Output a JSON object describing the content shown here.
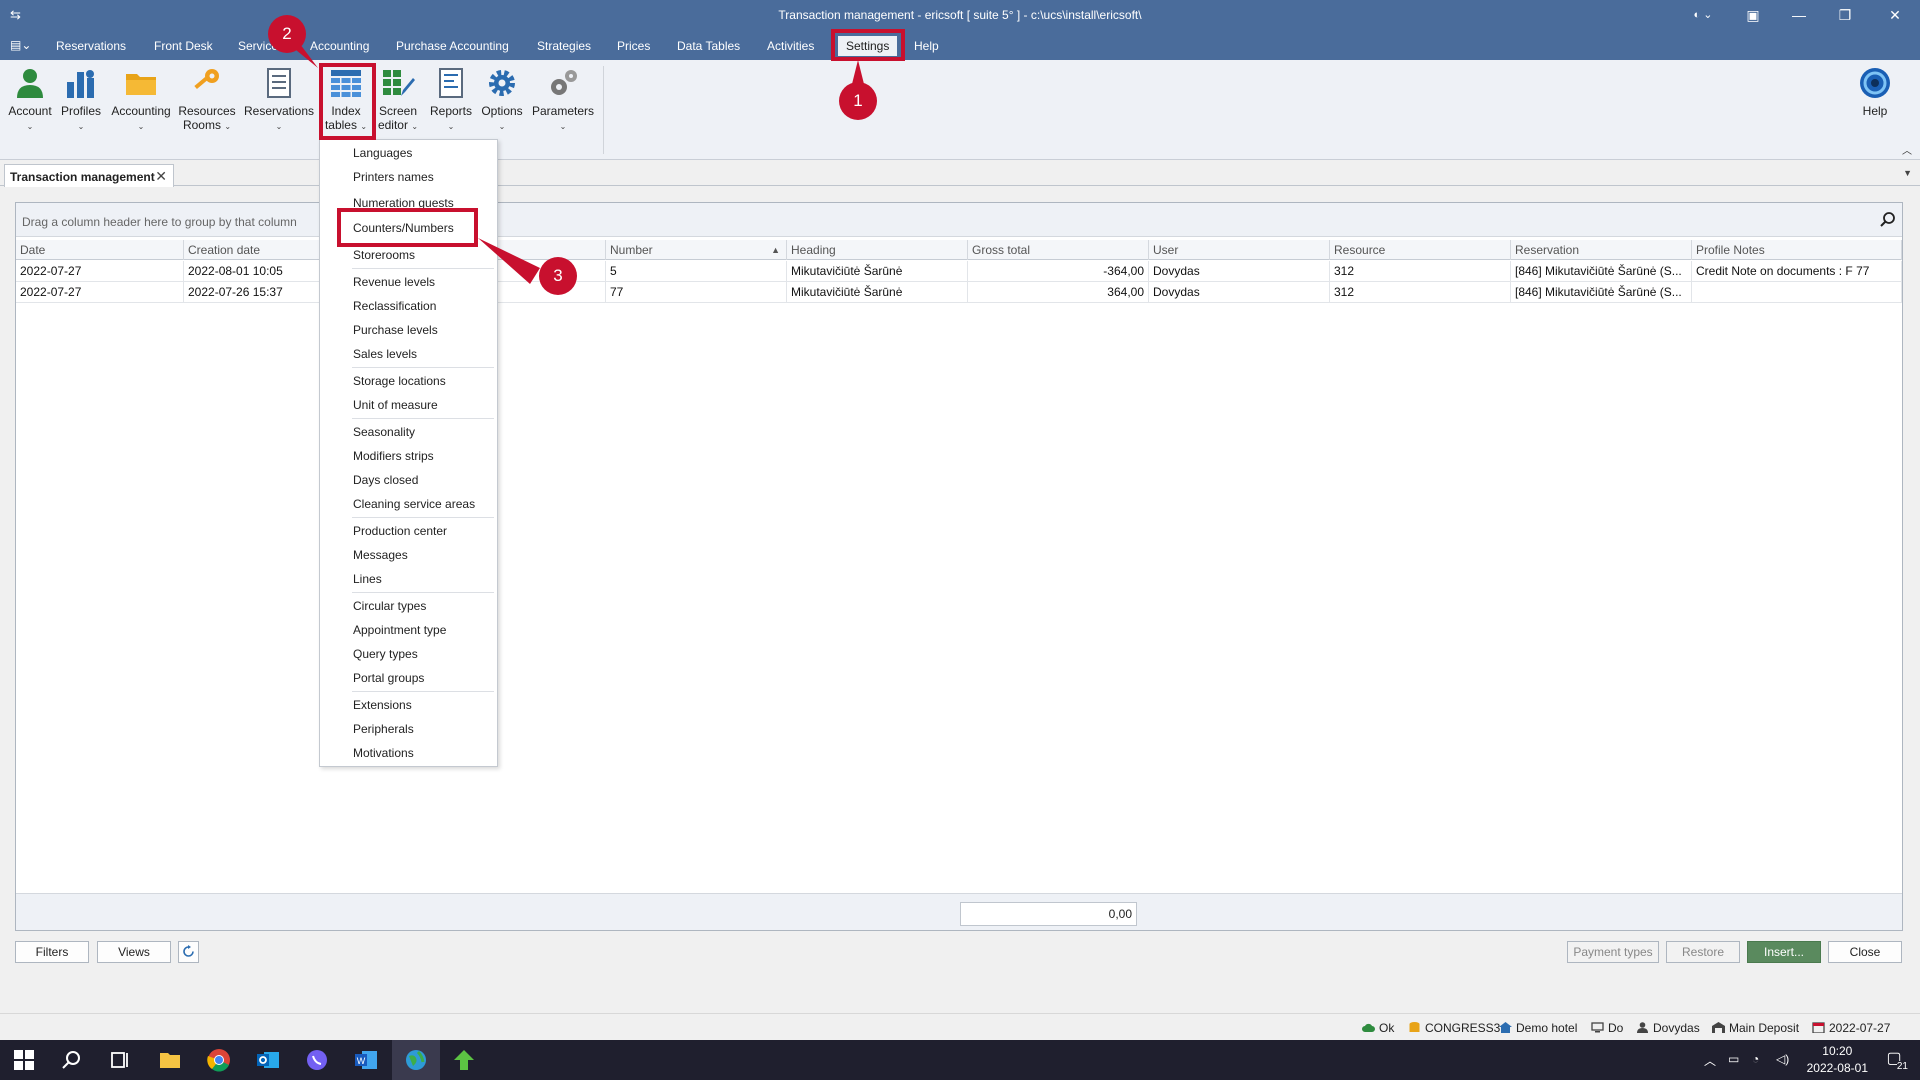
{
  "window": {
    "title": "Transaction management - ericsoft [ suite 5° ] - c:\\ucs\\install\\ericsoft\\"
  },
  "menu": {
    "items": [
      "Reservations",
      "Front Desk",
      "Services",
      "Accounting",
      "Purchase Accounting",
      "Strategies",
      "Prices",
      "Data Tables",
      "Activities",
      "Settings",
      "Help"
    ],
    "active": "Settings"
  },
  "ribbon": {
    "buttons": [
      {
        "line1": "Account",
        "line2": ""
      },
      {
        "line1": "Profiles",
        "line2": ""
      },
      {
        "line1": "Accounting",
        "line2": ""
      },
      {
        "line1": "Resources",
        "line2": "Rooms"
      },
      {
        "line1": "Reservations",
        "line2": ""
      },
      {
        "line1": "Index",
        "line2": "tables"
      },
      {
        "line1": "Screen",
        "line2": "editor"
      },
      {
        "line1": "Reports",
        "line2": ""
      },
      {
        "line1": "Options",
        "line2": ""
      },
      {
        "line1": "Parameters",
        "line2": ""
      }
    ],
    "help": "Help"
  },
  "tab": {
    "label": "Transaction management"
  },
  "grid": {
    "group_hint": "Drag a column header here to group by that column",
    "columns": [
      "Date",
      "Creation date",
      "",
      "Number",
      "Heading",
      "Gross total",
      "User",
      "Resource",
      "Reservation",
      "Profile Notes"
    ],
    "rows": [
      [
        "2022-07-27",
        "2022-08-01 10:05",
        "",
        "5",
        "Mikutavičiūtė Šarūnė",
        "-364,00",
        "Dovydas",
        "312",
        "[846] Mikutavičiūtė Šarūnė (S...",
        "Credit Note on documents : F 77"
      ],
      [
        "2022-07-27",
        "2022-07-26 15:37",
        "",
        "77",
        "Mikutavičiūtė Šarūnė",
        "364,00",
        "Dovydas",
        "312",
        "[846] Mikutavičiūtė Šarūnė (S...",
        ""
      ]
    ],
    "total": "0,00"
  },
  "dropdown": {
    "groups": [
      [
        "Languages",
        "Printers names",
        "Numeration guests",
        "Counters/Numbers",
        "Storerooms"
      ],
      [
        "Revenue levels",
        "Reclassification",
        "Purchase levels",
        "Sales levels"
      ],
      [
        "Storage locations",
        "Unit of measure"
      ],
      [
        "Seasonality",
        "Modifiers strips",
        "Days closed",
        "Cleaning service areas"
      ],
      [
        "Production center",
        "Messages",
        "Lines"
      ],
      [
        "Circular types",
        "Appointment type",
        "Query types",
        "Portal groups"
      ],
      [
        "Extensions",
        "Peripherals",
        "Motivations"
      ]
    ]
  },
  "buttons": {
    "filters": "Filters",
    "views": "Views",
    "payment_types": "Payment types",
    "restore": "Restore",
    "insert": "Insert...",
    "close": "Close"
  },
  "status": {
    "connection": "Ok",
    "database": "CONGRESS3",
    "hotel": "Demo hotel",
    "workstation": "Do",
    "user": "Dovydas",
    "deposit": "Main Deposit",
    "date": "2022-07-27"
  },
  "taskbar": {
    "time": "10:20",
    "date": "2022-08-01",
    "notifications": "21"
  },
  "annotations": [
    "1",
    "2",
    "3"
  ],
  "colors": {
    "titlebar": "#4a6c9b",
    "annotation": "#c8102e",
    "insert_button": "#5a8a5e"
  }
}
